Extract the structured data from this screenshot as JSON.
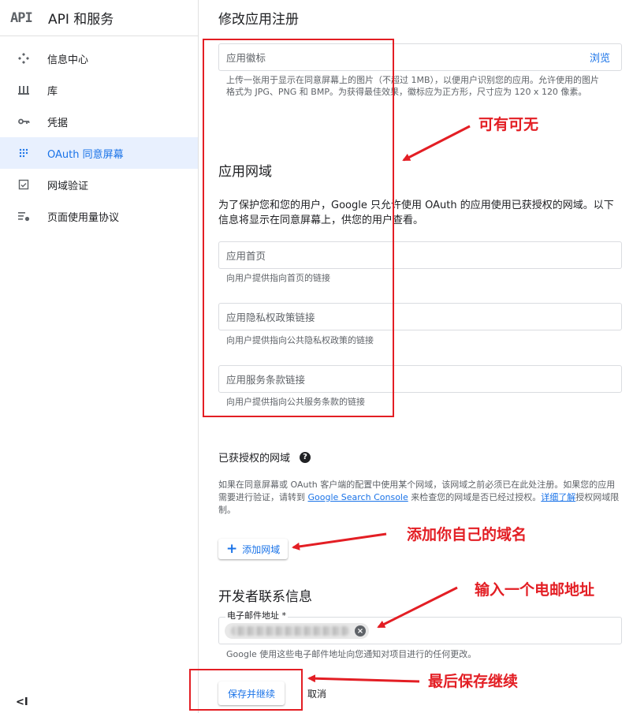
{
  "brand": {
    "logo": "API",
    "title": "API 和服务"
  },
  "sidebar": {
    "items": [
      {
        "label": "信息中心",
        "icon": "dashboard-icon"
      },
      {
        "label": "库",
        "icon": "library-icon"
      },
      {
        "label": "凭据",
        "icon": "key-icon"
      },
      {
        "label": "OAuth 同意屏幕",
        "icon": "oauth-consent-icon",
        "active": true
      },
      {
        "label": "网域验证",
        "icon": "domain-verification-icon"
      },
      {
        "label": "页面使用量协议",
        "icon": "page-usage-icon"
      }
    ],
    "collapse": "<I"
  },
  "main": {
    "title": "修改应用注册",
    "logo_field": {
      "placeholder": "应用徽标",
      "browse": "浏览"
    },
    "logo_hint": "上传一张用于显示在同意屏幕上的图片（不超过 1MB），以便用户识别您的应用。允许使用的图片格式为 JPG、PNG 和 BMP。为获得最佳效果，徽标应为正方形，尺寸应为 120 x 120 像素。",
    "app_domain": {
      "title": "应用网域",
      "description": "为了保护您和您的用户，Google 只允许使用 OAuth 的应用使用已获授权的网域。以下信息将显示在同意屏幕上，供您的用户查看。",
      "homepage": {
        "placeholder": "应用首页",
        "hint": "向用户提供指向首页的链接"
      },
      "privacy": {
        "placeholder": "应用隐私权政策链接",
        "hint": "向用户提供指向公共隐私权政策的链接"
      },
      "terms": {
        "placeholder": "应用服务条款链接",
        "hint": "向用户提供指向公共服务条款的链接"
      }
    },
    "authorized_domains": {
      "title": "已获授权的网域",
      "text_1": "如果在同意屏幕或 OAuth 客户端的配置中使用某个网域，该网域之前必须已在此处注册。如果您的应用需要进行验证，请转到 ",
      "link_console": "Google Search Console",
      "text_2": " 来检查您的网域是否已经过授权。",
      "link_more": "详细了解",
      "text_3": "授权网域限制。",
      "add_button": "添加网域"
    },
    "developer": {
      "title": "开发者联系信息",
      "email_label": "电子邮件地址 *",
      "email_hint": "Google 使用这些电子邮件地址向您通知对项目进行的任何更改。"
    },
    "save_button": "保存并继续",
    "cancel_button": "取消"
  },
  "annotations": {
    "optional": "可有可无",
    "add_domain": "添加你自己的域名",
    "enter_email": "输入一个电邮地址",
    "save_continue": "最后保存继续",
    "color": "#e31e24"
  }
}
